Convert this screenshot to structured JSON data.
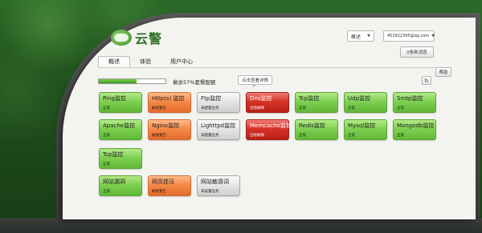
{
  "header": {
    "logo_text": "云警",
    "view_select": "概述",
    "account_select": "451922345@qq.com",
    "messages_button": "0条新消息",
    "help_button": "帮助"
  },
  "tabs": [
    {
      "label": "概述",
      "active": true
    },
    {
      "label": "体验",
      "active": false
    },
    {
      "label": "用户中心",
      "active": false
    }
  ],
  "quota": {
    "used_fraction": 0.57,
    "text": "剩余57%套餐配额"
  },
  "tooltip": "点击查看详情",
  "tiles": [
    {
      "name": "Ping监控",
      "status": "正常",
      "state": "ok"
    },
    {
      "name": "Http(s) 监控",
      "status": "触发警告",
      "state": "warn"
    },
    {
      "name": "Ftp监控",
      "status": "未配置任务",
      "state": "off"
    },
    {
      "name": "Dns监控",
      "status": "出现故障",
      "state": "err"
    },
    {
      "name": "Tcp监控",
      "status": "正常",
      "state": "ok"
    },
    {
      "name": "Udp监控",
      "status": "正常",
      "state": "ok"
    },
    {
      "name": "Smtp监控",
      "status": "正常",
      "state": "ok"
    },
    {
      "name": "Apache监控",
      "status": "正常",
      "state": "ok"
    },
    {
      "name": "Nginx监控",
      "status": "触发警告",
      "state": "warn"
    },
    {
      "name": "Lighttpd监控",
      "status": "未配置任务",
      "state": "off"
    },
    {
      "name": "Memcache监控",
      "status": "出现故障",
      "state": "err"
    },
    {
      "name": "Redis监控",
      "status": "正常",
      "state": "ok"
    },
    {
      "name": "Mysql监控",
      "status": "正常",
      "state": "ok"
    },
    {
      "name": "Mongodb监控",
      "status": "正常",
      "state": "ok"
    },
    {
      "name": "Tcp监控",
      "status": "正常",
      "state": "ok"
    },
    {
      "name": "网站漏洞",
      "status": "正常",
      "state": "ok"
    },
    {
      "name": "网页挂马",
      "status": "触发警告",
      "state": "warn"
    },
    {
      "name": "网站敏感词",
      "status": "未设置任务",
      "state": "off"
    }
  ],
  "colors": {
    "ok": "#7fd052",
    "warn": "#f68a49",
    "err": "#d63228",
    "off": "#e4e4e4",
    "brand": "#2c6e25"
  }
}
